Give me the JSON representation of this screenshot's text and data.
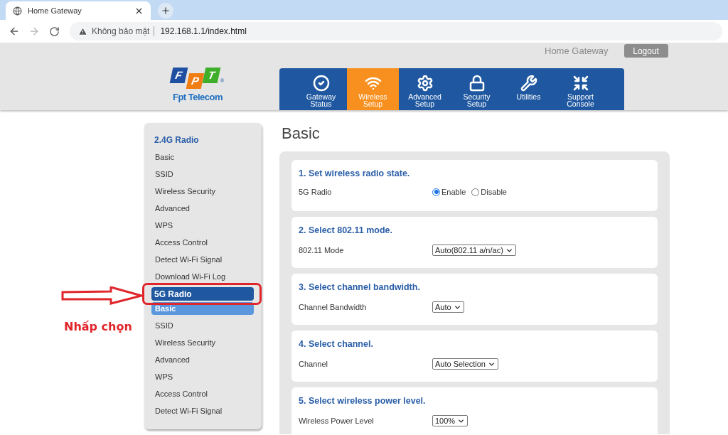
{
  "browser": {
    "tab_title": "Home Gateway",
    "back_disabled": false,
    "forward_disabled": true,
    "security_label": "Không bảo mật",
    "url": "192.168.1.1/index.html"
  },
  "header": {
    "product": "Home Gateway",
    "logout": "Logout",
    "logo": {
      "letters": [
        "F",
        "P",
        "T"
      ],
      "registered": "®",
      "company": "Fpt Telecom"
    }
  },
  "nav": [
    {
      "label": "Gateway Status",
      "selected": false
    },
    {
      "label": "Wireless Setup",
      "selected": true
    },
    {
      "label": "Advanced Setup",
      "selected": false
    },
    {
      "label": "Security Setup",
      "selected": false
    },
    {
      "label": "Utilities",
      "selected": false
    },
    {
      "label": "Support Console",
      "selected": false
    }
  ],
  "sidebar": {
    "groups": [
      {
        "label": "2.4G Radio",
        "selected": false,
        "children": [
          {
            "label": "Basic",
            "selected": false
          },
          {
            "label": "SSID",
            "selected": false
          },
          {
            "label": "Wireless Security",
            "selected": false
          },
          {
            "label": "Advanced",
            "selected": false
          },
          {
            "label": "WPS",
            "selected": false
          },
          {
            "label": "Access Control",
            "selected": false
          },
          {
            "label": "Detect Wi-Fi Signal",
            "selected": false
          },
          {
            "label": "Download Wi-Fi Log",
            "selected": false
          }
        ]
      },
      {
        "label": "5G Radio",
        "selected": true,
        "children": [
          {
            "label": "Basic",
            "selected": true
          },
          {
            "label": "SSID",
            "selected": false
          },
          {
            "label": "Wireless Security",
            "selected": false
          },
          {
            "label": "Advanced",
            "selected": false
          },
          {
            "label": "WPS",
            "selected": false
          },
          {
            "label": "Access Control",
            "selected": false
          },
          {
            "label": "Detect Wi-Fi Signal",
            "selected": false
          }
        ]
      }
    ]
  },
  "annotation": {
    "label": "Nhấp chọn"
  },
  "page_title": "Basic",
  "sections": [
    {
      "title": "1. Set wireless radio state.",
      "label": "5G Radio",
      "kind": "radio",
      "options": [
        {
          "label": "Enable",
          "selected": true
        },
        {
          "label": "Disable",
          "selected": false
        }
      ]
    },
    {
      "title": "2. Select 802.11 mode.",
      "label": "802.11 Mode",
      "kind": "select",
      "value": "Auto(802.11 a/n/ac)"
    },
    {
      "title": "3. Select channel bandwidth.",
      "label": "Channel Bandwidth",
      "kind": "select",
      "value": "Auto"
    },
    {
      "title": "4. Select channel.",
      "label": "Channel",
      "kind": "select",
      "value": "Auto Selection"
    },
    {
      "title": "5. Select wireless power level.",
      "label": "Wireless Power Level",
      "kind": "select",
      "value": "100%"
    }
  ]
}
